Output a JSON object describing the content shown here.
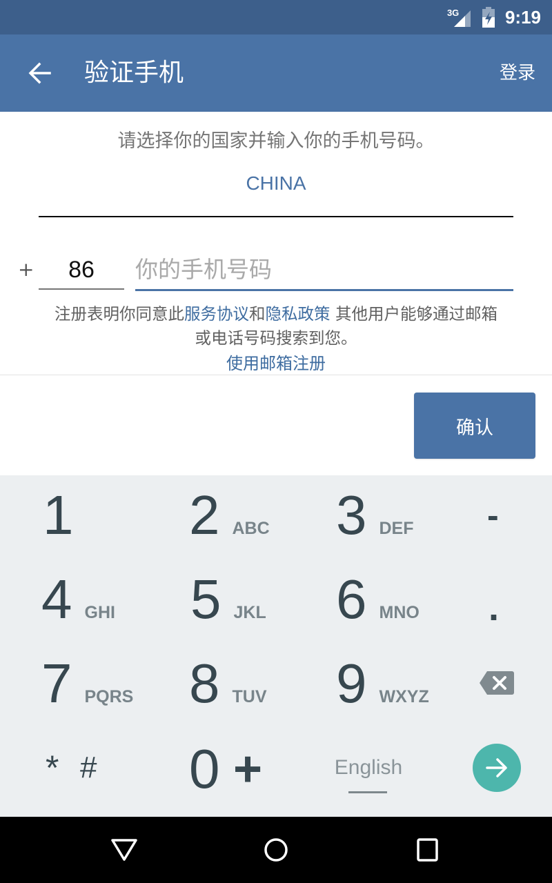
{
  "status_bar": {
    "network_label": "3G",
    "signal_icon": "signal-icon",
    "battery_icon": "battery-charging-icon",
    "time": "9:19"
  },
  "app_bar": {
    "back_icon": "arrow-left-icon",
    "title": "验证手机",
    "login_label": "登录"
  },
  "form": {
    "instruction": "请选择你的国家并输入你的手机号码。",
    "country": "CHINA",
    "plus": "+",
    "country_code": "86",
    "phone_value": "",
    "phone_placeholder": "你的手机号码",
    "terms": {
      "prefix": "注册表明你同意此",
      "terms_link": "服务协议",
      "and": "和",
      "privacy_link": "隐私政策",
      "suffix": " 其他用户能够通过邮箱",
      "line2": "或电话号码搜索到您。"
    },
    "email_signup_link": "使用邮箱注册",
    "confirm_label": "确认"
  },
  "keyboard": {
    "keys": [
      {
        "num": "1",
        "letters": ""
      },
      {
        "num": "2",
        "letters": "ABC"
      },
      {
        "num": "3",
        "letters": "DEF"
      },
      {
        "num": "-",
        "letters": ""
      },
      {
        "num": "4",
        "letters": "GHI"
      },
      {
        "num": "5",
        "letters": "JKL"
      },
      {
        "num": "6",
        "letters": "MNO"
      },
      {
        "num": ".",
        "letters": ""
      },
      {
        "num": "7",
        "letters": "PQRS"
      },
      {
        "num": "8",
        "letters": "TUV"
      },
      {
        "num": "9",
        "letters": "WXYZ"
      }
    ],
    "star": "*",
    "hash": "#",
    "zero": "0",
    "plus": "+",
    "language": "English",
    "backspace_icon": "backspace-icon",
    "go_icon": "arrow-right-icon",
    "accent_color": "#4db6ac"
  },
  "nav_bar": {
    "back": "back-triangle-icon",
    "home": "home-circle-icon",
    "recents": "recents-square-icon"
  },
  "colors": {
    "primary": "#4a73a6",
    "status_bar": "#3d5f8b",
    "link": "#3e6ca0",
    "keyboard_bg": "#eceff1"
  }
}
